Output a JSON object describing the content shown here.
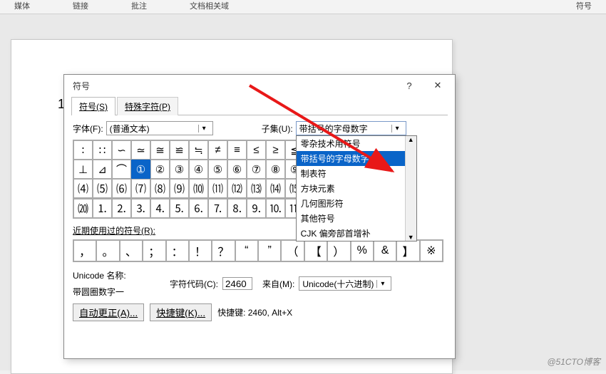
{
  "ribbon": {
    "items": [
      "媒体",
      "链接",
      "批注",
      "文档相关域",
      "符号"
    ]
  },
  "page": {
    "number": "1"
  },
  "dialog": {
    "title": "符号",
    "help": "?",
    "close": "✕",
    "tabs": {
      "symbols": "符号(S)",
      "special": "特殊字符(P)"
    },
    "font_label": "字体(F):",
    "font_value": "(普通文本)",
    "subset_label": "子集(U):",
    "subset_value": "带括号的字母数字",
    "subset_options": [
      "零杂技术用符号",
      "带括号的字母数字",
      "制表符",
      "方块元素",
      "几何图形符",
      "其他符号",
      "CJK 偏旁部首增补"
    ],
    "subset_selected_index": 1,
    "grid_rows": [
      [
        "∶",
        "∷",
        "∽",
        "≃",
        "≅",
        "≌",
        "≒",
        "≠",
        "≡",
        "≤",
        "≥",
        "≦"
      ],
      [
        "⊥",
        "⊿",
        "⌒",
        "①",
        "②",
        "③",
        "④",
        "⑤",
        "⑥",
        "⑦",
        "⑧",
        "⑨"
      ],
      [
        "⑷",
        "⑸",
        "⑹",
        "⑺",
        "⑻",
        "⑼",
        "⑽",
        "⑾",
        "⑿",
        "⒀",
        "⒁",
        "⒂"
      ],
      [
        "⒇",
        "⒈",
        "⒉",
        "⒊",
        "⒋",
        "⒌",
        "⒍",
        "⒎",
        "⒏",
        "⒐",
        "⒑",
        "⒒"
      ]
    ],
    "selected_cell": {
      "row": 1,
      "col": 3
    },
    "recent_label": "近期使用过的符号(R):",
    "recent": [
      "，",
      "。",
      "、",
      "；",
      "：",
      "！",
      "？",
      "“",
      "”",
      "（",
      "【",
      "）",
      "%",
      "&",
      "】",
      "※"
    ],
    "unicode_name_label": "Unicode 名称:",
    "char_name": "带圆圈数字一",
    "code_label": "字符代码(C):",
    "code_value": "2460",
    "from_label": "来自(M):",
    "from_value": "Unicode(十六进制)",
    "autocorrect_btn": "自动更正(A)...",
    "shortcut_btn": "快捷键(K)...",
    "shortcut_label": "快捷键: 2460, Alt+X"
  },
  "watermark": "@51CTO博客"
}
